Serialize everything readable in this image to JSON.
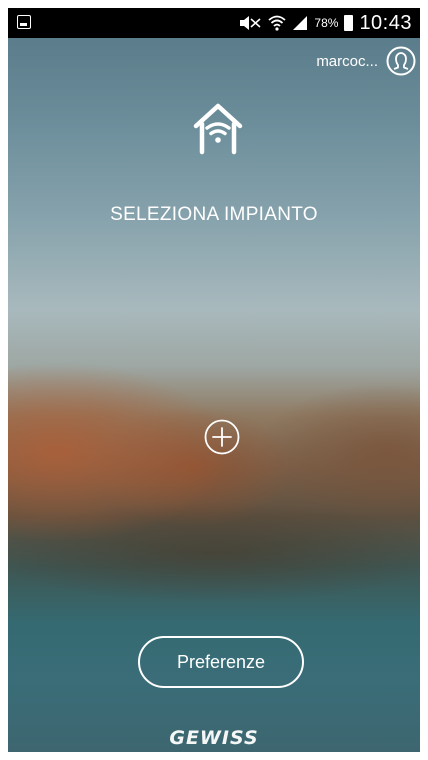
{
  "status_bar": {
    "battery_percent": "78%",
    "time": "10:43",
    "icons": [
      "image-notification-icon",
      "mute-icon",
      "wifi-icon",
      "signal-icon",
      "battery-icon"
    ]
  },
  "header": {
    "username": "marcoc...",
    "avatar_icon": "user-avatar-icon"
  },
  "main": {
    "house_icon": "smart-home-wifi-icon",
    "title": "SELEZIONA IMPIANTO",
    "add_icon": "plus-circle-icon"
  },
  "footer": {
    "preferences_label": "Preferenze",
    "logo_text": "GEWISS"
  },
  "colors": {
    "status_bar_bg": "#000000",
    "foreground": "#ffffff"
  }
}
